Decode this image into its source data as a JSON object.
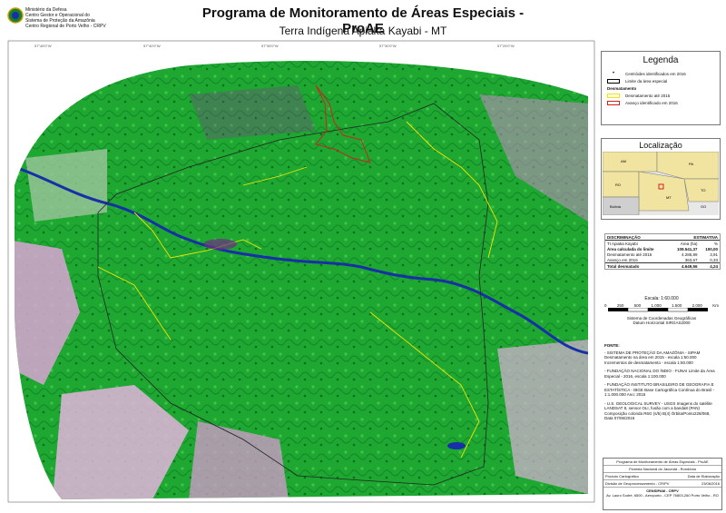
{
  "header": {
    "title": "Programa de Monitoramento de Áreas Especiais - ProAE",
    "subtitle": "Terra Indígena Apiaka Kayabi - MT"
  },
  "org": {
    "line1": "Ministério da Defesa",
    "line2": "Centro Gestor e Operacional do",
    "line3": "Sistema de Proteção da Amazônia",
    "line4": "Centro Regional de Porto Velho - CRPV"
  },
  "legend": {
    "title": "Legenda",
    "items": [
      {
        "label": "Centróides identificados em 2016",
        "color": "#000000"
      },
      {
        "label": "Limite da área especial",
        "color": "#000000"
      },
      {
        "label": "Desmatamento até 2015",
        "color": "#f2e600"
      },
      {
        "label": "Avanço identificado em 2016",
        "color": "#d0221b"
      }
    ],
    "section": "Desmatamento"
  },
  "location": {
    "title": "Localização",
    "states": [
      "AM",
      "PA",
      "RO",
      "MT",
      "TO",
      "GO",
      "Bolívia"
    ]
  },
  "discriminacao": {
    "headers": [
      "DISCRIMINAÇÃO",
      "ESTIMATIVA",
      "",
      "Área (ha)",
      "%"
    ],
    "rows": [
      [
        "TI Apiaka Kayabi",
        "Área (ha)",
        "%"
      ],
      [
        "Área calculada do limite",
        "109.541,37",
        "100,00"
      ],
      [
        "Desmatamento até 2015",
        "4.285,89",
        "3,91"
      ],
      [
        "Avanço em 2016",
        "363,67",
        "0,33"
      ],
      [
        "Total desmatado",
        "4.649,56",
        "4,24"
      ]
    ]
  },
  "scale": {
    "label": "Escala: 1:60.000",
    "ticks": [
      "0",
      "250",
      "500",
      "1.000",
      "1.500",
      "2.000"
    ],
    "unit": "Km",
    "system": "Sistema de Coordenadas Geográficas",
    "datum": "Datum Horizontal SIRGAS2000"
  },
  "fonte": {
    "title": "FONTE:",
    "sections": [
      "- SISTEMA DE PROTEÇÃO DA AMAZÔNIA - SIPAM Desmatamento na área em 2015 - escala 1:50.000 Incrementos de desmatamento - escala 1:50.000",
      "- FUNDAÇÃO NACIONAL DO ÍNDIO - FUNAI Limite da Área Especial - 2016, escala 1:100.000",
      "- FUNDAÇÃO INSTITUTO BRASILEIRO DE GEOGRAFIA E ESTATÍSTICA - IBGE Base Cartográfica Contínua do Brasil - 1:1.000.000 Ano: 2015",
      "- U.S. GEOLOGICAL SURVEY - USGS Imagens do satélite LANDSAT 8, sensor OLI, fusão com a banda8 (PAN) Composição colorida R6G (s/5) B(4) Órbita/Ponto228/068, Data 07/06/2016"
    ]
  },
  "footer": {
    "program": "Programa de Monitoramento de Áreas Especiais - ProAE",
    "subtitle": "Floresta Nacional do Jacundá - Rondônia",
    "product": "Produto Cartográfico",
    "division": "Divisão de Geoprocessamento - CR/PV",
    "date_label": "Data de Elaboração",
    "date": "23/06/2016",
    "org": "CENSIPAM - CRPV",
    "address": "Av. Lauro Sodré, 6500 - Aeroporto - CEP 76803-260 Porto Velho - RO"
  },
  "colors": {
    "forest": "#1ea832",
    "forest_dark": "#0d7a22",
    "deforested": "#d99ad1",
    "river": "#1730a6",
    "boundary": "#222222",
    "deforest_line": "#f2e600",
    "advance": "#d0221b"
  }
}
